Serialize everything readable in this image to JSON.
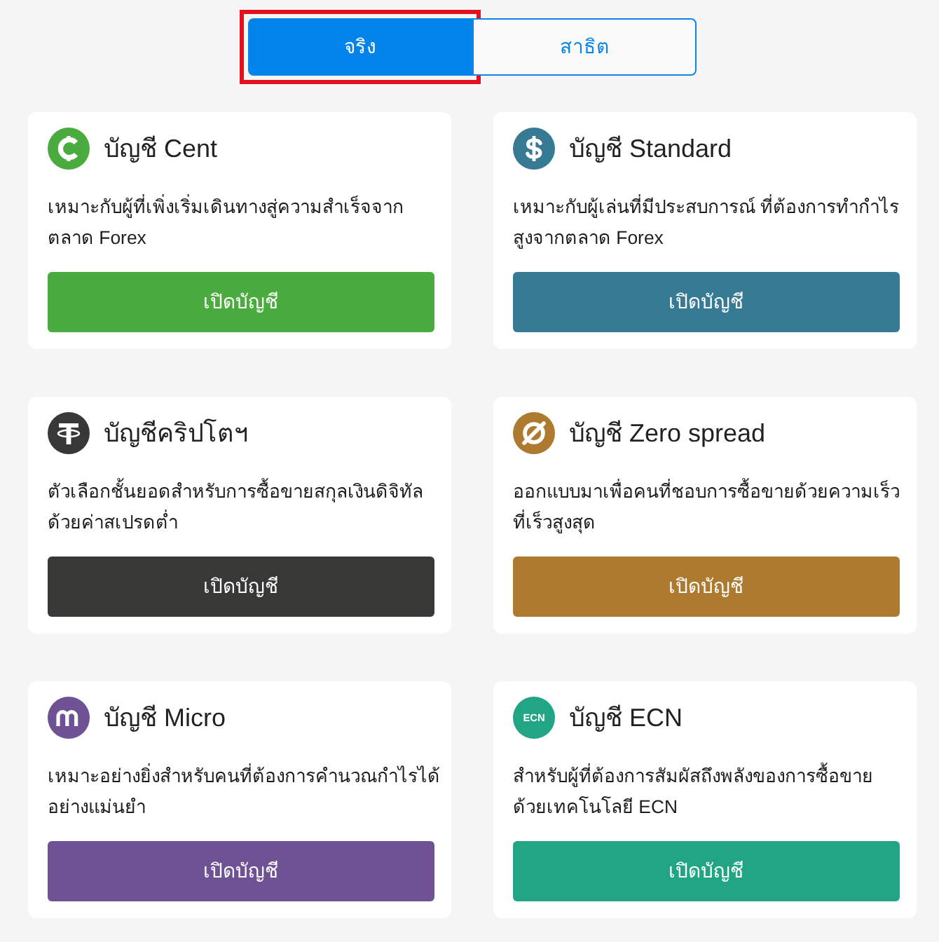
{
  "tabs": [
    {
      "label": "จริง",
      "selected": true,
      "highlighted": true
    },
    {
      "label": "สาธิต",
      "selected": false,
      "highlighted": false
    }
  ],
  "accounts": [
    {
      "kind": "cent",
      "color": "#4aac3e",
      "title": "บัญชี Cent",
      "description": "เหมาะกับผู้ที่เพิ่งเริ่มเดินทางสู่ความสำเร็จจากตลาด Forex",
      "button": "เปิดบัญชี"
    },
    {
      "kind": "dollar",
      "color": "#377a94",
      "title": "บัญชี Standard",
      "description": "เหมาะกับผู้เล่นที่มีประสบการณ์ ที่ต้องการทำกำไรสูงจากตลาด Forex",
      "button": "เปิดบัญชี"
    },
    {
      "kind": "tether",
      "color": "#383837",
      "title": "บัญชีคริปโตฯ",
      "description": "ตัวเลือกชั้นยอดสำหรับการซื้อขายสกุลเงินดิจิทัลด้วยค่าสเปรดต่ำ",
      "button": "เปิดบัญชี"
    },
    {
      "kind": "zero",
      "color": "#ad7a30",
      "title": "บัญชี Zero spread",
      "description": "ออกแบบมาเพื่อคนที่ชอบการซื้อขายด้วยความเร็วที่เร็วสูงสุด",
      "button": "เปิดบัญชี"
    },
    {
      "kind": "micro",
      "color": "#6e5294",
      "title": "บัญชี Micro",
      "description": "เหมาะอย่างยิ่งสำหรับคนที่ต้องการคำนวณกำไรได้อย่างแม่นยำ",
      "button": "เปิดบัญชี"
    },
    {
      "kind": "text",
      "icon_text": "ECN",
      "color": "#22a584",
      "title": "บัญชี ECN",
      "description": "สำหรับผู้ที่ต้องการสัมผัสถึงพลังของการซื้อขายด้วยเทคโนโลยี ECN",
      "button": "เปิดบัญชี"
    }
  ]
}
